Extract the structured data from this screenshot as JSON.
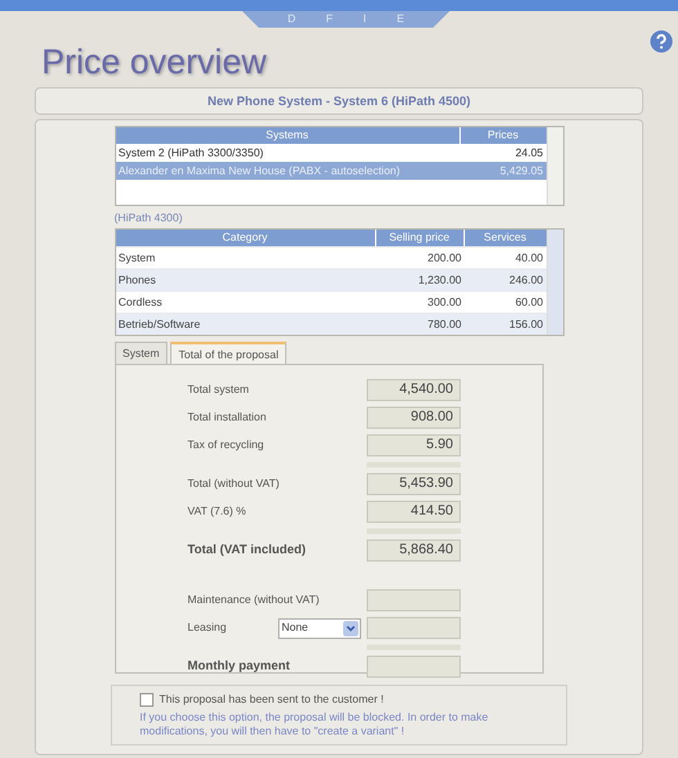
{
  "nav_letters": [
    "D",
    "F",
    "I",
    "E"
  ],
  "title": "Price overview",
  "header": "New Phone System  -  System 6  (HiPath 4500)",
  "systems_table": {
    "columns": [
      "Systems",
      "Prices"
    ],
    "rows": [
      {
        "cells": [
          "System 2  (HiPath 3300/3350)",
          "24.05"
        ],
        "selected": false
      },
      {
        "cells": [
          "Alexander en Maxima New House  (PABX - autoselection)",
          "5,429.05"
        ],
        "selected": true
      }
    ]
  },
  "subtitle": "(HiPath 4300)",
  "category_table": {
    "columns": [
      "Category",
      "Selling price",
      "Services"
    ],
    "rows": [
      {
        "cells": [
          "System",
          "200.00",
          "40.00"
        ],
        "selected": false
      },
      {
        "cells": [
          "Phones",
          "1,230.00",
          "246.00"
        ],
        "selected": false
      },
      {
        "cells": [
          "Cordless",
          "300.00",
          "60.00"
        ],
        "selected": false
      },
      {
        "cells": [
          "Betrieb/Software",
          "780.00",
          "156.00"
        ],
        "selected": false
      }
    ]
  },
  "tabs": [
    {
      "label": "System",
      "selected": false
    },
    {
      "label": "Total of the proposal",
      "selected": true
    }
  ],
  "total_groups": [
    [
      {
        "label": "Total system",
        "value": "4,540.00",
        "bold": false
      },
      {
        "label": "Total installation",
        "value": "908.00",
        "bold": false
      },
      {
        "label": "Tax of recycling",
        "value": "5.90",
        "bold": false
      }
    ],
    [
      {
        "label": "Total (without VAT)",
        "value": "5,453.90",
        "bold": false
      },
      {
        "label": "VAT (7.6) %",
        "value": "414.50",
        "bold": false
      }
    ],
    [
      {
        "label": "Total (VAT included)",
        "value": "5,868.40",
        "bold": true
      }
    ]
  ],
  "payment_rows": [
    {
      "kind": "field",
      "label": "Maintenance (without VAT)",
      "bold": false
    },
    {
      "kind": "select",
      "label": "Leasing",
      "option": "None",
      "bold": false
    },
    {
      "kind": "spacer"
    },
    {
      "kind": "field",
      "label": "Monthly payment",
      "bold": true
    }
  ],
  "sent": {
    "checked": false,
    "label": "This proposal has been sent to the customer !",
    "note": "If you choose this option, the proposal will be blocked. In order to make modifications, you will then have to \"create a variant\" !"
  }
}
